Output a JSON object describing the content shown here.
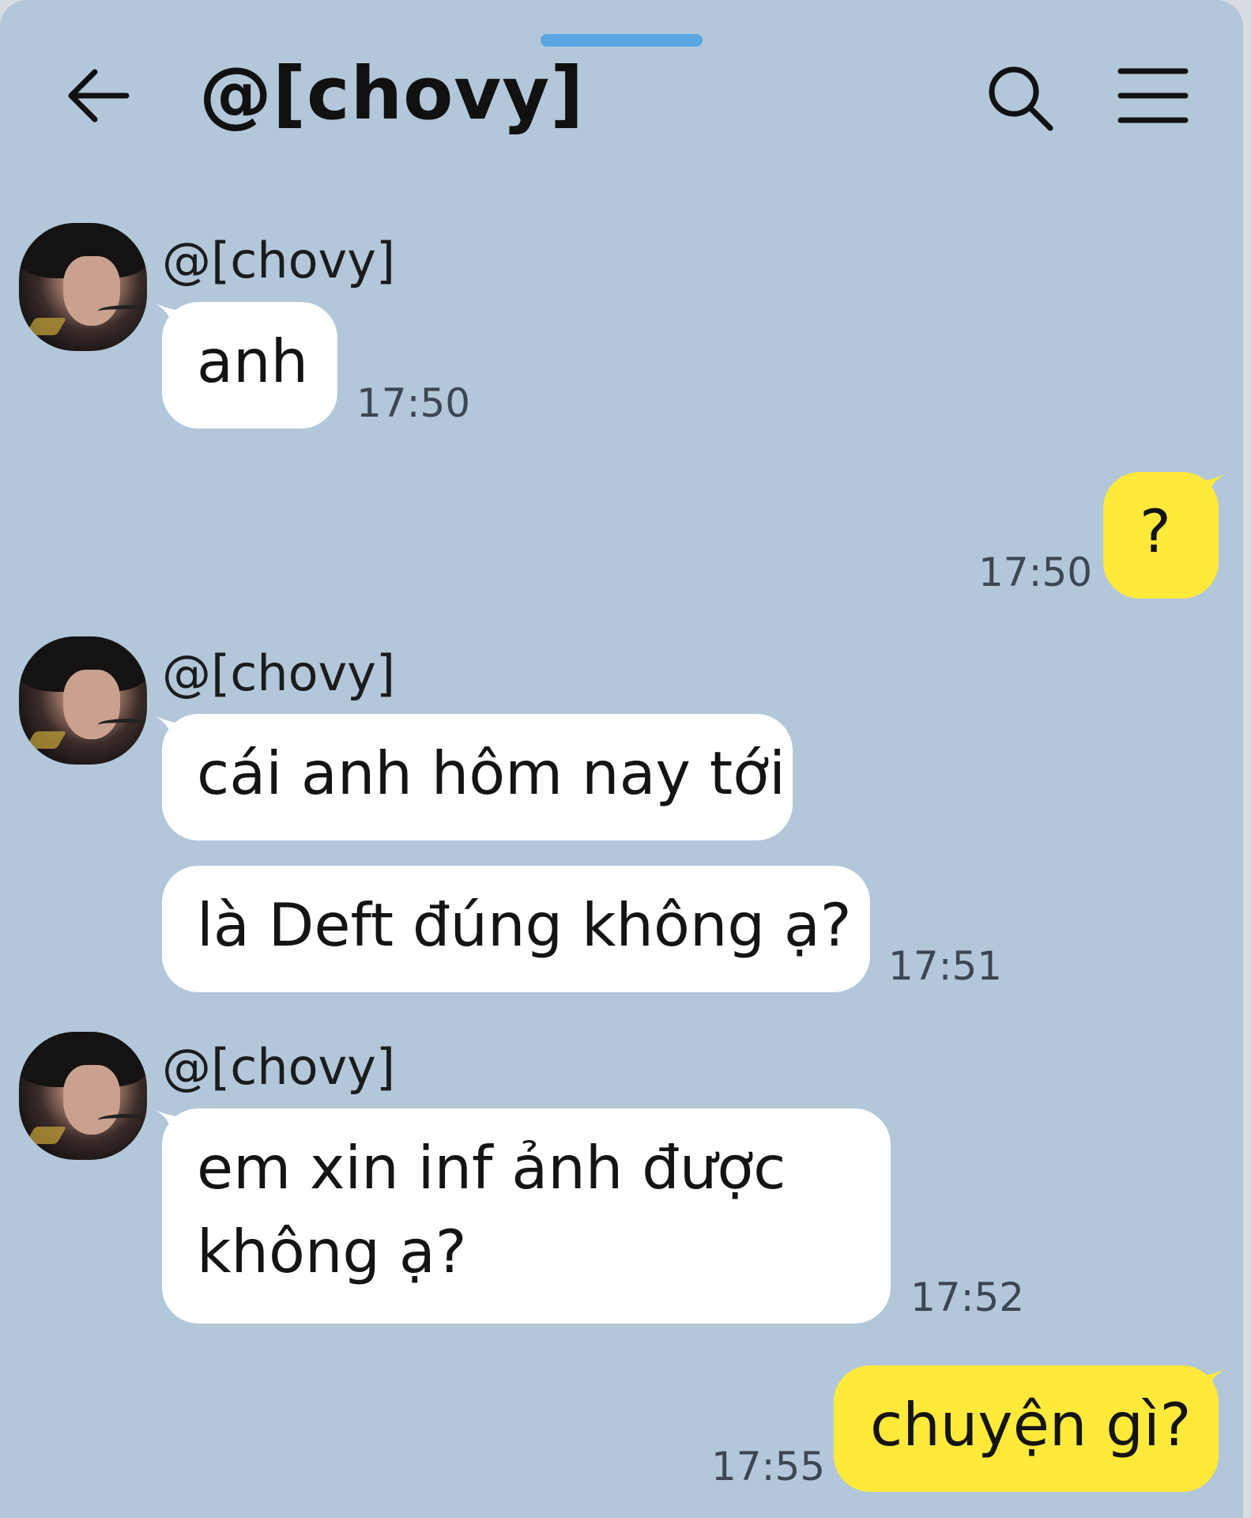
{
  "header": {
    "title": "@[chovy]",
    "back_icon": "arrow-left-icon",
    "search_icon": "search-icon",
    "menu_icon": "hamburger-menu-icon"
  },
  "messages": [
    {
      "sender": "@[chovy]",
      "text": "anh",
      "time": "17:50",
      "from_me": false
    },
    {
      "text": "?",
      "time": "17:50",
      "from_me": true
    },
    {
      "sender": "@[chovy]",
      "text": "cái anh hôm nay tới",
      "from_me": false
    },
    {
      "text": "là Deft đúng không ạ?",
      "time": "17:51",
      "from_me": false
    },
    {
      "sender": "@[chovy]",
      "text_line1": "em xin inf ảnh được",
      "text_line2": "không ạ?",
      "time": "17:52",
      "from_me": false
    },
    {
      "text": "chuyện gì?",
      "time": "17:55",
      "from_me": true
    }
  ],
  "colors": {
    "background": "#b2c7da",
    "incoming_bubble": "#ffffff",
    "outgoing_bubble": "#ffe93a",
    "accent": "#5aa6e3"
  }
}
